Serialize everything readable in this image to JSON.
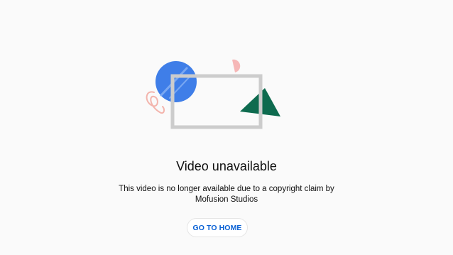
{
  "error": {
    "title": "Video unavailable",
    "message": "This video is no longer available due to a copyright claim by Mofusion Studios",
    "home_button_label": "GO TO HOME"
  },
  "colors": {
    "circle": "#3f7ee8",
    "triangle": "#0e6b4f",
    "frame": "#cccccc",
    "squiggle": "#f3b5ad",
    "half_circle": "#f6b7b7",
    "button_text": "#065fd4"
  },
  "icons": [
    "blue-circle-shape",
    "green-triangle-shape",
    "pink-squiggle-shape",
    "pink-half-circle-shape",
    "video-frame-shape"
  ]
}
